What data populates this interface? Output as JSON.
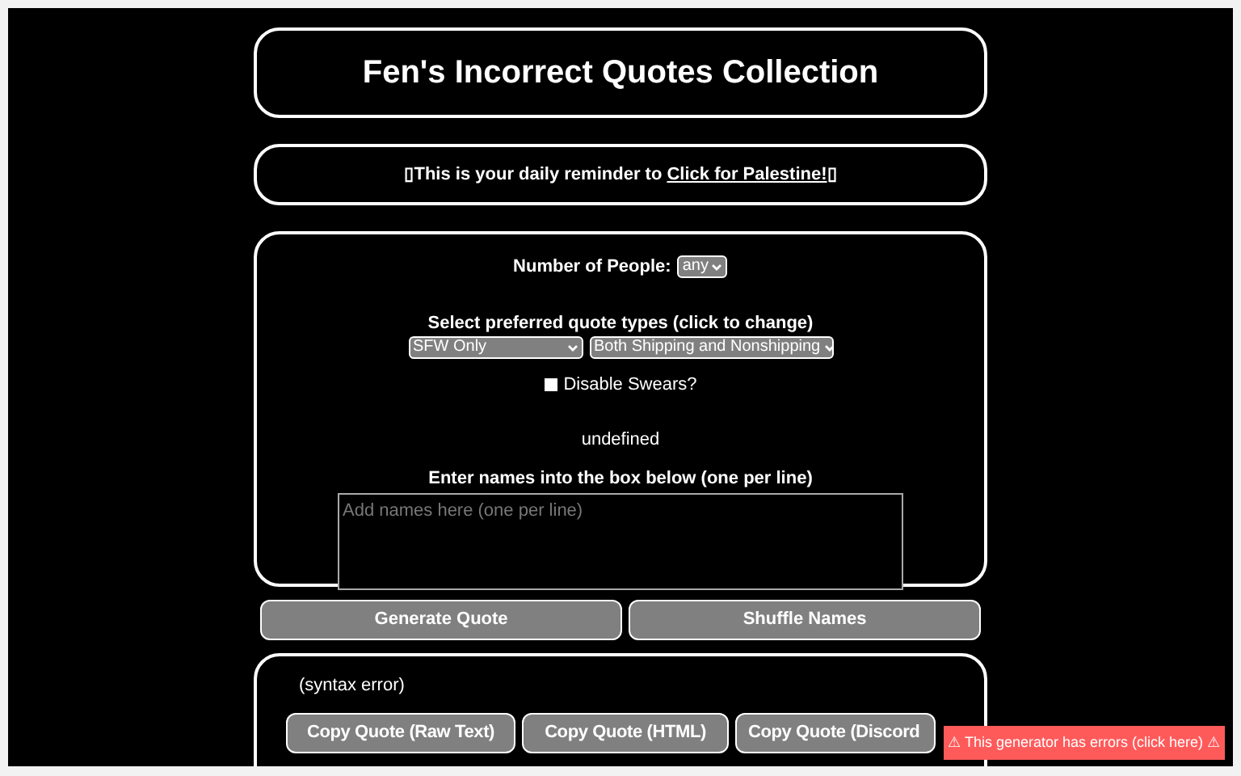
{
  "title": "Fen's Incorrect Quotes Collection",
  "reminder": {
    "lead": "▯",
    "text": "This is your daily reminder to ",
    "link": "Click for Palestine!",
    "tail": "▯"
  },
  "settings": {
    "people_label": "Number of People:",
    "people_value": "any",
    "types_label": "Select preferred quote types (click to change)",
    "type_selects": [
      "SFW Only",
      "Both Shipping and Nonshipping"
    ],
    "swears": {
      "label": "Disable Swears?",
      "checked": false
    },
    "status": "undefined",
    "names_label": "Enter names into the box below (one per line)",
    "names_placeholder": "Add names here (one per line)"
  },
  "actions": [
    "Generate Quote",
    "Shuffle Names"
  ],
  "output": {
    "text": "(syntax error)",
    "copy_buttons": [
      "Copy Quote (Raw Text)",
      "Copy Quote (HTML)",
      "Copy Quote (Discord"
    ]
  },
  "error_banner": "⚠ This generator has errors (click here) ⚠"
}
